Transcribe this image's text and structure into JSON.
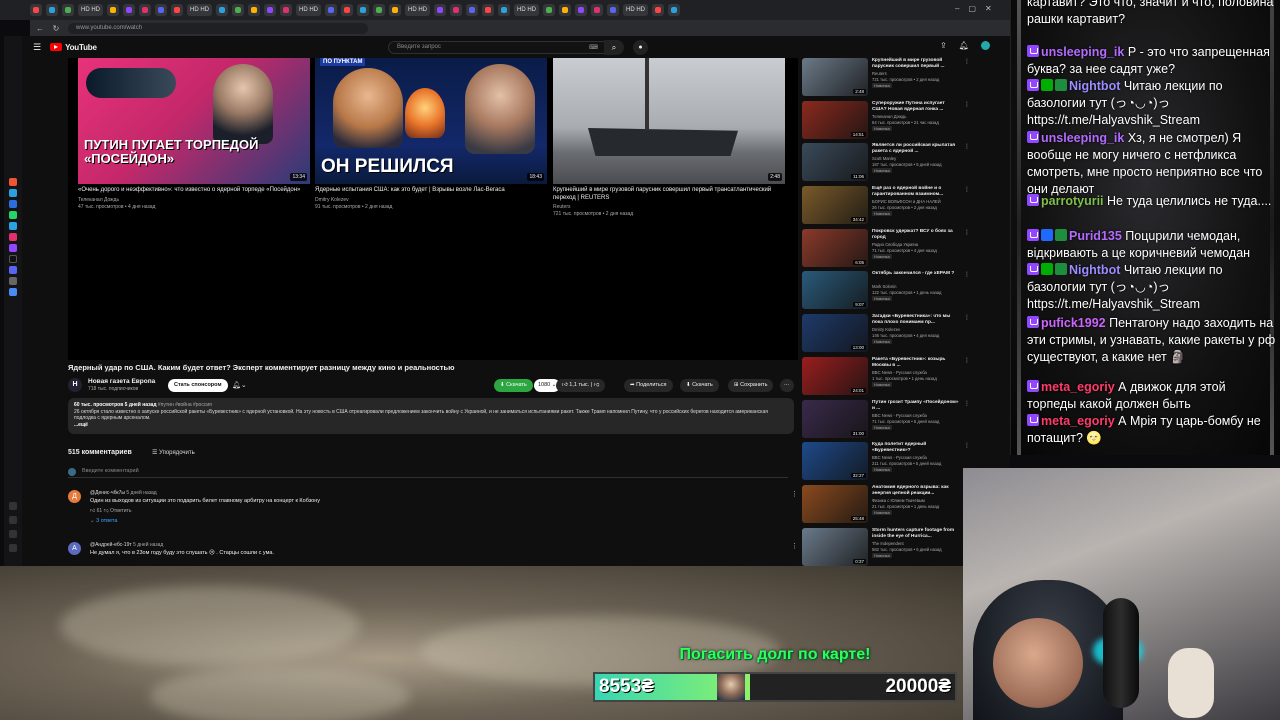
{
  "browser": {
    "tabs": [
      "",
      "",
      "",
      "",
      "",
      "",
      "",
      "",
      "",
      "",
      "",
      "",
      "",
      "",
      "",
      "",
      "",
      "",
      "",
      "",
      "",
      "",
      "",
      "",
      "",
      "",
      "",
      "",
      "",
      ""
    ],
    "tab_labels": [
      "HD HD",
      "HD HD",
      "HD HD",
      "HD HD",
      "HD HD",
      "HD HD"
    ],
    "url": "www.youtube.com/watch"
  },
  "youtube": {
    "logo": "YouTube",
    "logo_region": "UA",
    "search_placeholder": "Введите запрос",
    "endcards": [
      {
        "title": "«Очень дорого и неэффективно»: что известно о ядерной торпеде «Посейдон»",
        "channel": "Телеканал Дождь",
        "stats": "47 тыс. просмотров • 4 дня назад",
        "duration": "13:34",
        "overlay": "ПУТИН ПУГАЕТ ТОРПЕДОЙ «ПОСЕЙДОН»"
      },
      {
        "title": "Ядерные испытания США: как это будет | Взрывы возле Лас-Вегаса",
        "channel": "Dmitry Kolezev",
        "stats": "91 тыс. просмотров • 2 дня назад",
        "duration": "18:43",
        "overlay": "ОН РЕШИЛСЯ",
        "overlay_top": "ПО ПУНКТАМ"
      },
      {
        "title": "Крупнейший в мире грузовой парусник совершил первый трансатлантический переход | REUTERS",
        "channel": "Reuters",
        "stats": "721 тыс. просмотров • 2 дня назад",
        "duration": "2:48"
      }
    ],
    "video_title": "Ядерный удар по США. Каким будет ответ? Эксперт комментирует разницу между кино и реальностью",
    "channel_name": "Новая газета Европа",
    "channel_avatar": "Н",
    "channel_subs": "718 тыс. подписчиков",
    "sponsor_label": "Стать спонсором",
    "download_label": "Скачать",
    "quality_label": "1080",
    "like_count": "1,1 тыс.",
    "share_label": "Поделиться",
    "download2_label": "Скачать",
    "save_label": "Сохранить",
    "description_meta": "60 тыс. просмотров  5 дней назад",
    "description_tags": "#путин #война #россия",
    "description_text": "26 октября стало известно о запуске российской ракеты «Буревестник» с ядерной установкой. На эту новость в США отреагировали предложением закончить войну с Украиной, и не заниматься испытаниями ракет. Также Трамп напомнил Путину, что у российских берегов находится американская подлодка с ядерным арсеналом.",
    "description_more": "...ещё",
    "comments_count": "515 комментариев",
    "sort_label": "Упорядочить",
    "add_comment_placeholder": "Введите комментарий",
    "comments": [
      {
        "avatar": "Д",
        "author": "@Денис-чбк7ы",
        "time": "5 дней назад",
        "text": "Один из выходов из ситуации это подарить билет главному арбитру на концерт к Кобзону",
        "likes": "61",
        "reply_label": "Ответить",
        "replies": "3 ответа",
        "avatar_color": "#e67a3a"
      },
      {
        "avatar": "А",
        "author": "@Андрей-ебс-19т",
        "time": "5 дней назад",
        "text": "Не думал я, что в 23ом году буду это слушать 😢 . Старцы сошли с ума.",
        "avatar_color": "#5c6bc0"
      }
    ],
    "related": [
      {
        "title": "Крупнейший в мире грузовой парусник совершил первый ...",
        "channel": "Reuters",
        "stats": "721 тыс. просмотров • 2 дня назад",
        "badge": "Новинка",
        "duration": "2:48",
        "color": "#6b7a88"
      },
      {
        "title": "Супероружие Путина испугает США? Новая ядерная гонка ...",
        "channel": "Телеканал Дождь",
        "stats": "54 тыс. просмотров • 21 час назад",
        "badge": "Новинка",
        "duration": "14:51",
        "color": "#8a2a1e"
      },
      {
        "title": "Является ли российская крылатая ракета с ядерной ...",
        "channel": "Scott Manley",
        "stats": "187 тыс. просмотров • 5 дней назад",
        "badge": "Новинка",
        "duration": "11:06",
        "color": "#3a4a5a"
      },
      {
        "title": "Ещё раз о ядерной войне и о гарантированном взаимном...",
        "channel": "БОРИС ВОЛЬФСОН и ДНА НАЛЕЙ",
        "stats": "26 тыс. просмотров • 2 дня назад",
        "badge": "Новинка",
        "duration": "34:42",
        "color": "#7a5a2a"
      },
      {
        "title": "Покровск удержат? ВСУ о боях за город",
        "channel": "Радио Свобода Україна",
        "stats": "71 тыс. просмотров • 4 дня назад",
        "badge": "Новинка",
        "duration": "6:05",
        "color": "#8a3a2a"
      },
      {
        "title": "Октябрь закончился - где хЕРАМ ?",
        "channel": "Mark Solonin",
        "stats": "122 тыс. просмотров • 1 день назад",
        "badge": "Новинка",
        "duration": "9:07",
        "color": "#2a5a7a"
      },
      {
        "title": "Загадки «Буревестника»: что мы пока плохо понимаем пр...",
        "channel": "Dmitry Kolezev",
        "stats": "146 тыс. просмотров • 4 дня назад",
        "badge": "Новинка",
        "duration": "13:00",
        "color": "#1e3a6a"
      },
      {
        "title": "Ракета «Буревестник»: козырь Москвы в ...",
        "channel": "BBC News - Русская служба",
        "stats": "1 тыс. просмотров • 1 день назад",
        "badge": "Новинка",
        "duration": "24:01",
        "color": "#9a1e1e"
      },
      {
        "title": "Путин грозит Трампу «Посейдоном» и ...",
        "channel": "BBC News - Русская служба",
        "stats": "71 тыс. просмотров • 5 дней назад",
        "badge": "Новинка",
        "duration": "31:00",
        "color": "#3a2a4a"
      },
      {
        "title": "Куда полетит ядерный «Буревестник»?",
        "channel": "BBC News - Русская служба",
        "stats": "211 тыс. просмотров • 5 дней назад",
        "badge": "Новинка",
        "duration": "32:27",
        "color": "#1e4a8a"
      },
      {
        "title": "Анатомия ядерного взрыва: как энергия цепной реакции...",
        "channel": "Физика с Юлием Ткачёвым",
        "stats": "21 тыс. просмотров • 1 день назад",
        "badge": "Новинка",
        "duration": "25:48",
        "color": "#8a4a1e"
      },
      {
        "title": "Storm hunters capture footage from inside the eye of Hurrica...",
        "channel": "The Independent",
        "stats": "582 тыс. просмотров • 5 дней назад",
        "badge": "Новинка",
        "duration": "0:37",
        "color": "#6a7a8a"
      }
    ]
  },
  "chat": {
    "messages": [
      {
        "nick": "",
        "text": "картавит? Это что, значит и что, половина рашки картавит?",
        "color": "#ffffff",
        "badges": []
      },
      {
        "nick": "unsleeping_ik",
        "text": "Р - это что запрещенная буква? за нее садят уже?",
        "color": "#b36bff",
        "badges": [
          "tw"
        ]
      },
      {
        "nick": "Nightbot",
        "text": "Читаю лекции по базологии тут (っ◔◡◔)っ https://t.me/Halyavshik_Stream",
        "color": "#9b8cff",
        "badges": [
          "tw",
          "mod",
          "ok"
        ]
      },
      {
        "nick": "unsleeping_ik",
        "text": "Хз, я не смотрел) Я вообще не могу ничего с нетфликса смотреть, мне просто неприятно все что они делают",
        "color": "#b36bff",
        "badges": [
          "tw"
        ]
      },
      {
        "nick": "parrotyurii",
        "text": "Не туда целились не туда....",
        "color": "#7fbf4a",
        "badges": [
          "tw"
        ]
      },
      {
        "nick": "Purid135",
        "text": "Поцupили чемодан, відкривають а це коричневий чемодан",
        "color": "#b36bff",
        "badges": [
          "tw",
          "blue",
          "ok"
        ]
      },
      {
        "nick": "Nightbot",
        "text": "Читаю лекции по базологии тут (っ◔◡◔)っ https://t.me/Halyavshik_Stream",
        "color": "#9b8cff",
        "badges": [
          "tw",
          "mod",
          "ok"
        ]
      },
      {
        "nick": "pufick1992",
        "text": "Пентагону надо заходить на эти стримы, и узнавать, какие ракеты у рф существуют, а какие нет 🗿",
        "color": "#cc66ff",
        "badges": [
          "tw"
        ]
      },
      {
        "nick": "meta_egoriy",
        "text": "А движок для этой торпеды какой должен быть",
        "color": "#ff3b6b",
        "badges": [
          "tw"
        ]
      },
      {
        "nick": "meta_egoriy",
        "text": "А Мрія ту царь-бомбу не потащит? 🌝",
        "color": "#ff3b6b",
        "badges": [
          "tw"
        ]
      }
    ]
  },
  "donation": {
    "title": "Погасить долг по карте!",
    "current": "8553₴",
    "goal": "20000₴",
    "progress": 0.43
  }
}
